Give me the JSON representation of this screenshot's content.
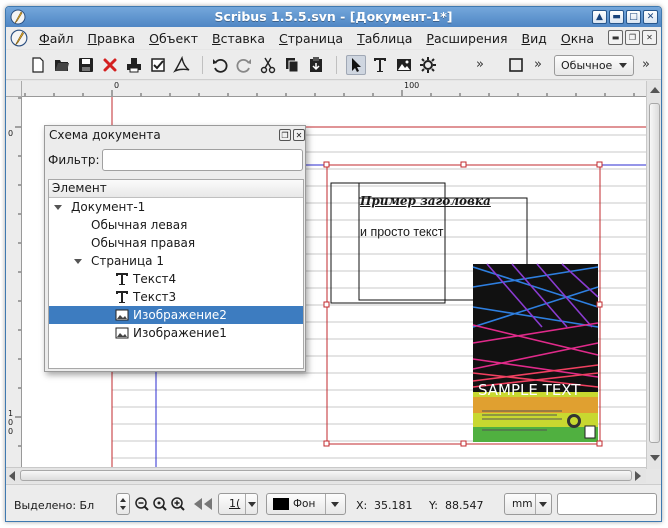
{
  "window": {
    "title": "Scribus 1.5.5.svn - [Документ-1*]"
  },
  "menu": {
    "items": [
      {
        "label": "Файл",
        "key": "file"
      },
      {
        "label": "Правка",
        "key": "edit"
      },
      {
        "label": "Объект",
        "key": "item"
      },
      {
        "label": "Вставка",
        "key": "insert"
      },
      {
        "label": "Страница",
        "key": "page"
      },
      {
        "label": "Таблица",
        "key": "table"
      },
      {
        "label": "Расширения",
        "key": "extras"
      },
      {
        "label": "Вид",
        "key": "view"
      },
      {
        "label": "Окна",
        "key": "windows"
      }
    ]
  },
  "toolbar": {
    "icons": [
      "new-document-icon",
      "open-icon",
      "save-icon",
      "close-icon",
      "print-icon",
      "preflight-check-icon",
      "export-pdf-icon",
      "undo-icon",
      "redo-icon",
      "cut-icon",
      "copy-icon",
      "paste-icon",
      "select-icon",
      "text-frame-icon",
      "image-frame-icon",
      "render-frame-icon",
      "frame-icon"
    ],
    "more": "»",
    "mode_value": "Обычное"
  },
  "rulers": {
    "h_labels": [
      "0",
      "100"
    ],
    "v_labels": [
      "0",
      "1",
      "0",
      "0"
    ]
  },
  "outline_panel": {
    "title": "Схема документа",
    "filter_label": "Фильтр:",
    "filter_value": "",
    "column_header": "Элемент",
    "rows": [
      {
        "label": "Документ-1",
        "kind": "document"
      },
      {
        "label": "Обычная левая",
        "kind": "master"
      },
      {
        "label": "Обычная правая",
        "kind": "master"
      },
      {
        "label": "Страница 1",
        "kind": "page"
      },
      {
        "label": "Текст4",
        "kind": "text"
      },
      {
        "label": "Текст3",
        "kind": "text"
      },
      {
        "label": "Изображение2",
        "kind": "image",
        "selected": true
      },
      {
        "label": "Изображение1",
        "kind": "image"
      }
    ]
  },
  "canvas": {
    "heading_text": "Пример заголовка",
    "body_text": "и просто текст",
    "image_caption": "SAMPLE TEXT"
  },
  "statusbar": {
    "selected_label": "Выделено: Бл",
    "zoom_value": "1(",
    "layer_label": "Фон",
    "x_label": "X:",
    "x_value": "35.181",
    "y_label": "Y:",
    "y_value": "88.547",
    "units": "mm"
  },
  "colors": {
    "titlebar": "#5a8fcb",
    "selection": "#3d7cc0",
    "page_border": "#c0282d",
    "margin_guide": "#2b2bd0"
  }
}
